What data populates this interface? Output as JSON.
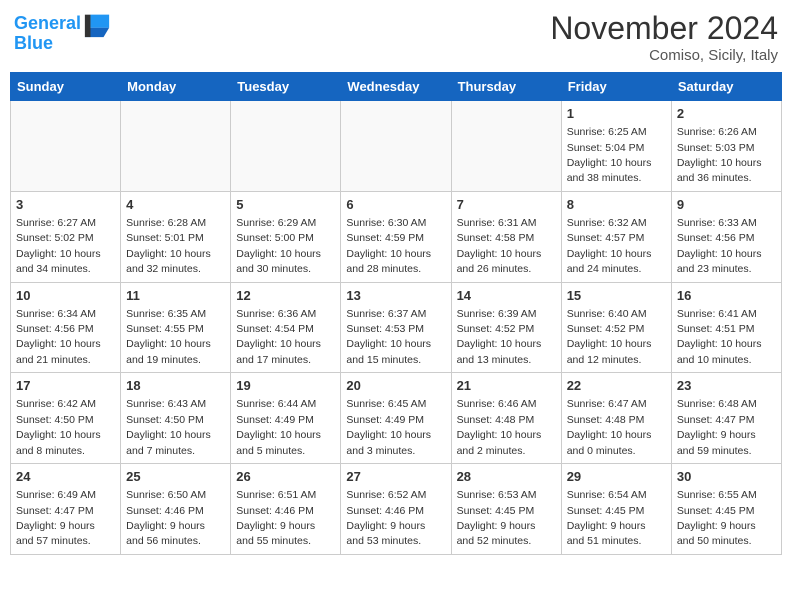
{
  "header": {
    "logo_line1": "General",
    "logo_line2": "Blue",
    "month_title": "November 2024",
    "location": "Comiso, Sicily, Italy"
  },
  "weekdays": [
    "Sunday",
    "Monday",
    "Tuesday",
    "Wednesday",
    "Thursday",
    "Friday",
    "Saturday"
  ],
  "weeks": [
    [
      {
        "day": "",
        "info": ""
      },
      {
        "day": "",
        "info": ""
      },
      {
        "day": "",
        "info": ""
      },
      {
        "day": "",
        "info": ""
      },
      {
        "day": "",
        "info": ""
      },
      {
        "day": "1",
        "info": "Sunrise: 6:25 AM\nSunset: 5:04 PM\nDaylight: 10 hours\nand 38 minutes."
      },
      {
        "day": "2",
        "info": "Sunrise: 6:26 AM\nSunset: 5:03 PM\nDaylight: 10 hours\nand 36 minutes."
      }
    ],
    [
      {
        "day": "3",
        "info": "Sunrise: 6:27 AM\nSunset: 5:02 PM\nDaylight: 10 hours\nand 34 minutes."
      },
      {
        "day": "4",
        "info": "Sunrise: 6:28 AM\nSunset: 5:01 PM\nDaylight: 10 hours\nand 32 minutes."
      },
      {
        "day": "5",
        "info": "Sunrise: 6:29 AM\nSunset: 5:00 PM\nDaylight: 10 hours\nand 30 minutes."
      },
      {
        "day": "6",
        "info": "Sunrise: 6:30 AM\nSunset: 4:59 PM\nDaylight: 10 hours\nand 28 minutes."
      },
      {
        "day": "7",
        "info": "Sunrise: 6:31 AM\nSunset: 4:58 PM\nDaylight: 10 hours\nand 26 minutes."
      },
      {
        "day": "8",
        "info": "Sunrise: 6:32 AM\nSunset: 4:57 PM\nDaylight: 10 hours\nand 24 minutes."
      },
      {
        "day": "9",
        "info": "Sunrise: 6:33 AM\nSunset: 4:56 PM\nDaylight: 10 hours\nand 23 minutes."
      }
    ],
    [
      {
        "day": "10",
        "info": "Sunrise: 6:34 AM\nSunset: 4:56 PM\nDaylight: 10 hours\nand 21 minutes."
      },
      {
        "day": "11",
        "info": "Sunrise: 6:35 AM\nSunset: 4:55 PM\nDaylight: 10 hours\nand 19 minutes."
      },
      {
        "day": "12",
        "info": "Sunrise: 6:36 AM\nSunset: 4:54 PM\nDaylight: 10 hours\nand 17 minutes."
      },
      {
        "day": "13",
        "info": "Sunrise: 6:37 AM\nSunset: 4:53 PM\nDaylight: 10 hours\nand 15 minutes."
      },
      {
        "day": "14",
        "info": "Sunrise: 6:39 AM\nSunset: 4:52 PM\nDaylight: 10 hours\nand 13 minutes."
      },
      {
        "day": "15",
        "info": "Sunrise: 6:40 AM\nSunset: 4:52 PM\nDaylight: 10 hours\nand 12 minutes."
      },
      {
        "day": "16",
        "info": "Sunrise: 6:41 AM\nSunset: 4:51 PM\nDaylight: 10 hours\nand 10 minutes."
      }
    ],
    [
      {
        "day": "17",
        "info": "Sunrise: 6:42 AM\nSunset: 4:50 PM\nDaylight: 10 hours\nand 8 minutes."
      },
      {
        "day": "18",
        "info": "Sunrise: 6:43 AM\nSunset: 4:50 PM\nDaylight: 10 hours\nand 7 minutes."
      },
      {
        "day": "19",
        "info": "Sunrise: 6:44 AM\nSunset: 4:49 PM\nDaylight: 10 hours\nand 5 minutes."
      },
      {
        "day": "20",
        "info": "Sunrise: 6:45 AM\nSunset: 4:49 PM\nDaylight: 10 hours\nand 3 minutes."
      },
      {
        "day": "21",
        "info": "Sunrise: 6:46 AM\nSunset: 4:48 PM\nDaylight: 10 hours\nand 2 minutes."
      },
      {
        "day": "22",
        "info": "Sunrise: 6:47 AM\nSunset: 4:48 PM\nDaylight: 10 hours\nand 0 minutes."
      },
      {
        "day": "23",
        "info": "Sunrise: 6:48 AM\nSunset: 4:47 PM\nDaylight: 9 hours\nand 59 minutes."
      }
    ],
    [
      {
        "day": "24",
        "info": "Sunrise: 6:49 AM\nSunset: 4:47 PM\nDaylight: 9 hours\nand 57 minutes."
      },
      {
        "day": "25",
        "info": "Sunrise: 6:50 AM\nSunset: 4:46 PM\nDaylight: 9 hours\nand 56 minutes."
      },
      {
        "day": "26",
        "info": "Sunrise: 6:51 AM\nSunset: 4:46 PM\nDaylight: 9 hours\nand 55 minutes."
      },
      {
        "day": "27",
        "info": "Sunrise: 6:52 AM\nSunset: 4:46 PM\nDaylight: 9 hours\nand 53 minutes."
      },
      {
        "day": "28",
        "info": "Sunrise: 6:53 AM\nSunset: 4:45 PM\nDaylight: 9 hours\nand 52 minutes."
      },
      {
        "day": "29",
        "info": "Sunrise: 6:54 AM\nSunset: 4:45 PM\nDaylight: 9 hours\nand 51 minutes."
      },
      {
        "day": "30",
        "info": "Sunrise: 6:55 AM\nSunset: 4:45 PM\nDaylight: 9 hours\nand 50 minutes."
      }
    ]
  ]
}
